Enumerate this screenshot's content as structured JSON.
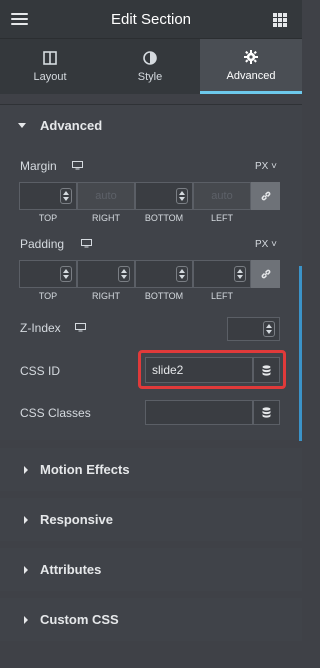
{
  "header": {
    "title": "Edit Section",
    "menu_icon": "hamburger-icon",
    "apps_icon": "grid-icon"
  },
  "tabs": [
    {
      "label": "Layout",
      "icon": "columns-icon",
      "active": false
    },
    {
      "label": "Style",
      "icon": "half-circle-icon",
      "active": false
    },
    {
      "label": "Advanced",
      "icon": "gear-icon",
      "active": true
    }
  ],
  "advanced": {
    "title": "Advanced",
    "margin": {
      "label": "Margin",
      "unit": "PX",
      "placeholders": [
        "",
        "auto",
        "",
        "auto"
      ],
      "sides": [
        "TOP",
        "RIGHT",
        "BOTTOM",
        "LEFT"
      ]
    },
    "padding": {
      "label": "Padding",
      "unit": "PX",
      "placeholders": [
        "",
        "",
        "",
        ""
      ],
      "sides": [
        "TOP",
        "RIGHT",
        "BOTTOM",
        "LEFT"
      ]
    },
    "zindex": {
      "label": "Z-Index",
      "value": ""
    },
    "css_id": {
      "label": "CSS ID",
      "value": "slide2"
    },
    "css_classes": {
      "label": "CSS Classes",
      "value": ""
    }
  },
  "collapsed_sections": [
    "Motion Effects",
    "Responsive",
    "Attributes",
    "Custom CSS"
  ],
  "colors": {
    "accent": "#6dc9ec",
    "highlight": "#e03a3a",
    "panel": "#404349",
    "header": "#34383c"
  }
}
